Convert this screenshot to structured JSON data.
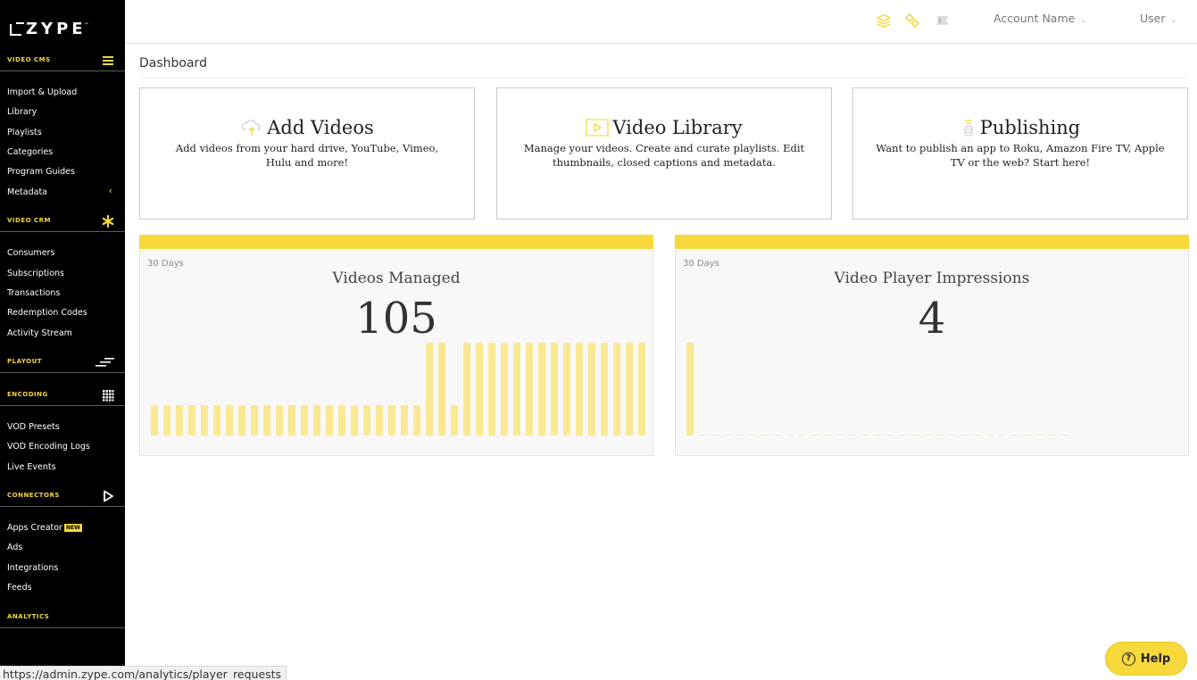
{
  "brand": {
    "logo_text": "ZYPE",
    "trademark": "™",
    "accent_color": "#f8d93c"
  },
  "sidebar": {
    "sections": [
      {
        "label": "VIDEO CMS",
        "icon": "menu-lines-icon",
        "items": [
          "Import & Upload",
          "Library",
          "Playlists",
          "Categories",
          "Program Guides",
          "Metadata"
        ]
      },
      {
        "label": "VIDEO CRM",
        "icon": "asterisk-icon",
        "items": [
          "Consumers",
          "Subscriptions",
          "Transactions",
          "Redemption Codes",
          "Activity Stream"
        ]
      },
      {
        "label": "PLAYOUT",
        "icon": "playout-lines-icon",
        "items": []
      },
      {
        "label": "ENCODING",
        "icon": "grid-icon",
        "items": [
          "VOD Presets",
          "VOD Encoding Logs",
          "Live Events"
        ]
      },
      {
        "label": "CONNECTORS",
        "icon": "play-outline-icon",
        "items": [
          "Apps Creator",
          "Ads",
          "Integrations",
          "Feeds"
        ]
      },
      {
        "label": "ANALYTICS",
        "icon": "",
        "items": []
      }
    ],
    "new_badge": "NEW",
    "metadata_chevron": "‹"
  },
  "header": {
    "icons": [
      "stack-icon",
      "gears-icon",
      "ticket-icon"
    ],
    "account_name": "Account Name",
    "user": "User",
    "caret": "⌄"
  },
  "main": {
    "page_title": "Dashboard",
    "cards": [
      {
        "title": "Add Videos",
        "icon": "cloud-upload-icon",
        "description": "Add videos from your hard drive, YouTube, Vimeo, Hulu and more!"
      },
      {
        "title": "Video Library",
        "icon": "video-play-icon",
        "description": "Manage your videos. Create and curate playlists. Edit thumbnails, closed captions and metadata."
      },
      {
        "title": "Publishing",
        "icon": "broadcast-icon",
        "description": "Want to publish an app to Roku, Amazon Fire TV, Apple TV or the web? Start here!"
      }
    ],
    "stats": [
      {
        "period": "30 Days",
        "title": "Videos Managed",
        "value": "105",
        "series": [
          33,
          33,
          33,
          33,
          33,
          33,
          33,
          33,
          33,
          33,
          33,
          33,
          33,
          33,
          33,
          33,
          33,
          33,
          33,
          33,
          33,
          33,
          100,
          100,
          33,
          100,
          100,
          100,
          100,
          100,
          100,
          100,
          100,
          100,
          100,
          100,
          100,
          100,
          100,
          100
        ]
      },
      {
        "period": "30 Days",
        "title": "Video Player Impressions",
        "value": "4",
        "series": [
          100,
          0,
          0,
          0,
          0,
          0,
          0,
          0,
          0,
          0,
          0,
          0,
          0,
          0,
          0,
          0,
          0,
          0,
          0,
          0,
          0,
          0,
          0,
          0,
          0,
          0,
          0,
          0,
          0,
          0,
          0
        ]
      }
    ]
  },
  "status_url": "https://admin.zype.com/analytics/player_requests",
  "help": {
    "label": "Help",
    "icon": "question-circle-icon"
  }
}
